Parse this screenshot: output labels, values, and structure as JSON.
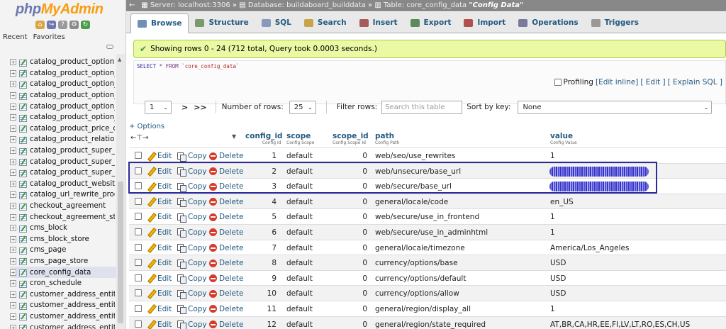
{
  "brand": {
    "logo_php": "php",
    "logo_myadmin": "MyAdmin"
  },
  "nav": {
    "tabs": [
      "Recent",
      "Favorites"
    ],
    "tables": [
      "catalog_product_option",
      "catalog_product_option_pr",
      "catalog_product_option_tit",
      "catalog_product_option_ty",
      "catalog_product_option_ty",
      "catalog_product_option_ty",
      "catalog_product_price_cl",
      "catalog_product_relation",
      "catalog_product_super_att",
      "catalog_product_super_att",
      "catalog_product_super_lin",
      "catalog_product_website",
      "catalog_url_rewrite_produc",
      "checkout_agreement",
      "checkout_agreement_store",
      "cms_block",
      "cms_block_store",
      "cms_page",
      "cms_page_store",
      "core_config_data",
      "cron_schedule",
      "customer_address_entity",
      "customer_address_entity_",
      "customer_address_entity_",
      "customer_address_entity"
    ],
    "active_table": "core_config_data"
  },
  "breadcrumb": {
    "server": "Server: localhost:3306",
    "database": "Database: buildaboard_builddata",
    "table": "Table: core_config_data",
    "title": "\"Config Data\""
  },
  "tabs": [
    {
      "label": "Browse",
      "icon": "browse-icon",
      "color": "#6f8fb8"
    },
    {
      "label": "Structure",
      "icon": "structure-icon",
      "color": "#7b9a6a"
    },
    {
      "label": "SQL",
      "icon": "sql-icon",
      "color": "#8899bb"
    },
    {
      "label": "Search",
      "icon": "search-icon",
      "color": "#c9a34a"
    },
    {
      "label": "Insert",
      "icon": "insert-icon",
      "color": "#a55c5c"
    },
    {
      "label": "Export",
      "icon": "export-icon",
      "color": "#5c8a5c"
    },
    {
      "label": "Import",
      "icon": "import-icon",
      "color": "#b05050"
    },
    {
      "label": "Operations",
      "icon": "operations-icon",
      "color": "#7a7a9a"
    },
    {
      "label": "Triggers",
      "icon": "triggers-icon",
      "color": "#999999"
    }
  ],
  "success_message": "Showing rows 0 - 24 (712 total, Query took 0.0003 seconds.)",
  "sql": {
    "select": "SELECT",
    "rest": " * FROM ",
    "table": "`core_config_data`"
  },
  "profiling": {
    "label": "Profiling",
    "edit_inline": "[Edit inline]",
    "edit": "[ Edit ]",
    "explain": "[ Explain SQL ]"
  },
  "pager": {
    "page": "1",
    "next": ">",
    "last": ">>",
    "rows_label": "Number of rows:",
    "rows_value": "25",
    "filter_label": "Filter rows:",
    "filter_placeholder": "Search this table",
    "sort_label": "Sort by key:",
    "sort_value": "None"
  },
  "options_link": "+ Options",
  "columns": [
    {
      "name": "config_id",
      "comment": "Config Id"
    },
    {
      "name": "scope",
      "comment": "Config Scope"
    },
    {
      "name": "scope_id",
      "comment": "Config Scope Id"
    },
    {
      "name": "path",
      "comment": "Config Path"
    },
    {
      "name": "value",
      "comment": "Config Value"
    }
  ],
  "actions": {
    "edit": "Edit",
    "copy": "Copy",
    "delete": "Delete"
  },
  "rows": [
    {
      "id": "1",
      "scope": "default",
      "scope_id": "0",
      "path": "web/seo/use_rewrites",
      "value": "1"
    },
    {
      "id": "2",
      "scope": "default",
      "scope_id": "0",
      "path": "web/unsecure/base_url",
      "value": ""
    },
    {
      "id": "3",
      "scope": "default",
      "scope_id": "0",
      "path": "web/secure/base_url",
      "value": ""
    },
    {
      "id": "4",
      "scope": "default",
      "scope_id": "0",
      "path": "general/locale/code",
      "value": "en_US"
    },
    {
      "id": "5",
      "scope": "default",
      "scope_id": "0",
      "path": "web/secure/use_in_frontend",
      "value": "1"
    },
    {
      "id": "6",
      "scope": "default",
      "scope_id": "0",
      "path": "web/secure/use_in_adminhtml",
      "value": "1"
    },
    {
      "id": "7",
      "scope": "default",
      "scope_id": "0",
      "path": "general/locale/timezone",
      "value": "America/Los_Angeles"
    },
    {
      "id": "8",
      "scope": "default",
      "scope_id": "0",
      "path": "currency/options/base",
      "value": "USD"
    },
    {
      "id": "9",
      "scope": "default",
      "scope_id": "0",
      "path": "currency/options/default",
      "value": "USD"
    },
    {
      "id": "10",
      "scope": "default",
      "scope_id": "0",
      "path": "currency/options/allow",
      "value": "USD"
    },
    {
      "id": "11",
      "scope": "default",
      "scope_id": "0",
      "path": "general/region/display_all",
      "value": "1"
    },
    {
      "id": "12",
      "scope": "default",
      "scope_id": "0",
      "path": "general/region/state_required",
      "value": "AT,BR,CA,HR,EE,FI,LV,LT,RO,ES,CH,US"
    }
  ],
  "redacted_rows": [
    "2",
    "3"
  ]
}
